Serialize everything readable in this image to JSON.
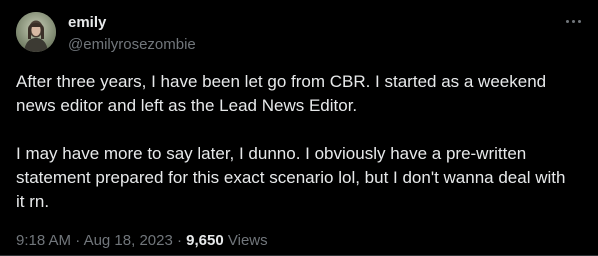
{
  "author": {
    "display_name": "emily",
    "handle": "@emilyrosezombie",
    "avatar_icon": "user-avatar"
  },
  "tweet": {
    "paragraphs": [
      "After three years, I have been let go from CBR. I started as a weekend news editor and left as the Lead News Editor.",
      "I may have more to say later, I dunno. I obviously have a pre-written statement prepared for this exact scenario lol, but I don't wanna deal with it rn."
    ]
  },
  "meta": {
    "time": "9:18 AM",
    "separator": "·",
    "date": "Aug 18, 2023",
    "views_count": "9,650",
    "views_label": "Views"
  },
  "icons": {
    "more": "more-options-icon"
  },
  "colors": {
    "background": "#000000",
    "primary_text": "#e7e9ea",
    "secondary_text": "#71767b"
  }
}
